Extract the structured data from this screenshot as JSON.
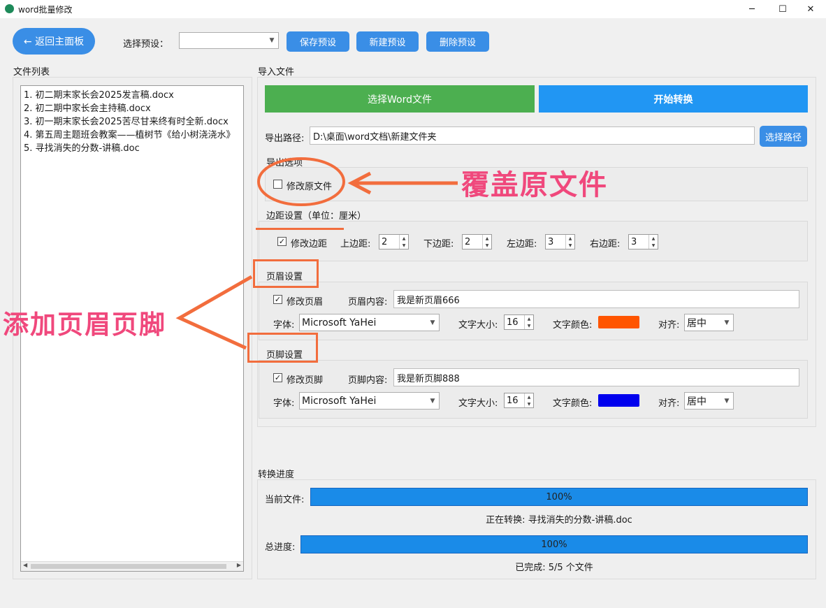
{
  "window": {
    "title": "word批量修改",
    "minimize": "─",
    "maximize": "☐",
    "close": "✕"
  },
  "toolbar": {
    "back_label": "← 返回主面板",
    "preset_label": "选择预设：",
    "preset_value": "",
    "save_label": "保存预设",
    "new_label": "新建预设",
    "delete_label": "删除预设"
  },
  "file_list": {
    "title": "文件列表",
    "items": [
      "1. 初二期末家长会2025发言稿.docx",
      "2. 初二期中家长会主持稿.docx",
      "3. 初一期末家长会2025苦尽甘来终有时全新.docx",
      "4. 第五周主题班会教案——植树节《给小树浇浇水》",
      "5. 寻找消失的分数-讲稿.doc"
    ]
  },
  "import": {
    "title": "导入文件",
    "select_word_label": "选择Word文件",
    "start_label": "开始转换",
    "export_path_label": "导出路径:",
    "export_path_value": "D:\\桌面\\word文档\\新建文件夹",
    "select_path_label": "选择路径"
  },
  "export_options": {
    "title": "导出选项",
    "overwrite_label": "修改原文件",
    "overwrite_checked": false
  },
  "margins": {
    "title": "边距设置（单位：厘米）",
    "modify_label": "修改边距",
    "modify_checked": true,
    "top_label": "上边距:",
    "top_value": "2",
    "bottom_label": "下边距:",
    "bottom_value": "2",
    "left_label": "左边距:",
    "left_value": "3",
    "right_label": "右边距:",
    "right_value": "3"
  },
  "header": {
    "title": "页眉设置",
    "modify_label": "修改页眉",
    "modify_checked": true,
    "content_label": "页眉内容:",
    "content_value": "我是新页眉666",
    "font_label": "字体:",
    "font_value": "Microsoft YaHei",
    "size_label": "文字大小:",
    "size_value": "16",
    "color_label": "文字颜色:",
    "color_value": "#ff5500",
    "align_label": "对齐:",
    "align_value": "居中"
  },
  "footer": {
    "title": "页脚设置",
    "modify_label": "修改页脚",
    "modify_checked": true,
    "content_label": "页脚内容:",
    "content_value": "我是新页脚888",
    "font_label": "字体:",
    "font_value": "Microsoft YaHei",
    "size_label": "文字大小:",
    "size_value": "16",
    "color_label": "文字颜色:",
    "color_value": "#0000ee",
    "align_label": "对齐:",
    "align_value": "居中"
  },
  "progress": {
    "title": "转换进度",
    "current_label": "当前文件:",
    "current_percent": "100%",
    "current_status": "正在转换: 寻找消失的分数-讲稿.doc",
    "total_label": "总进度:",
    "total_percent": "100%",
    "total_status": "已完成: 5/5 个文件"
  },
  "annotations": {
    "overwrite_text": "覆盖原文件",
    "header_footer_text": "添加页眉页脚",
    "color": "#f26d3d",
    "text_color": "#f0487c"
  },
  "colors": {
    "accent": "#3a8ee6",
    "green": "#4caf50",
    "progress": "#1a8be8"
  }
}
